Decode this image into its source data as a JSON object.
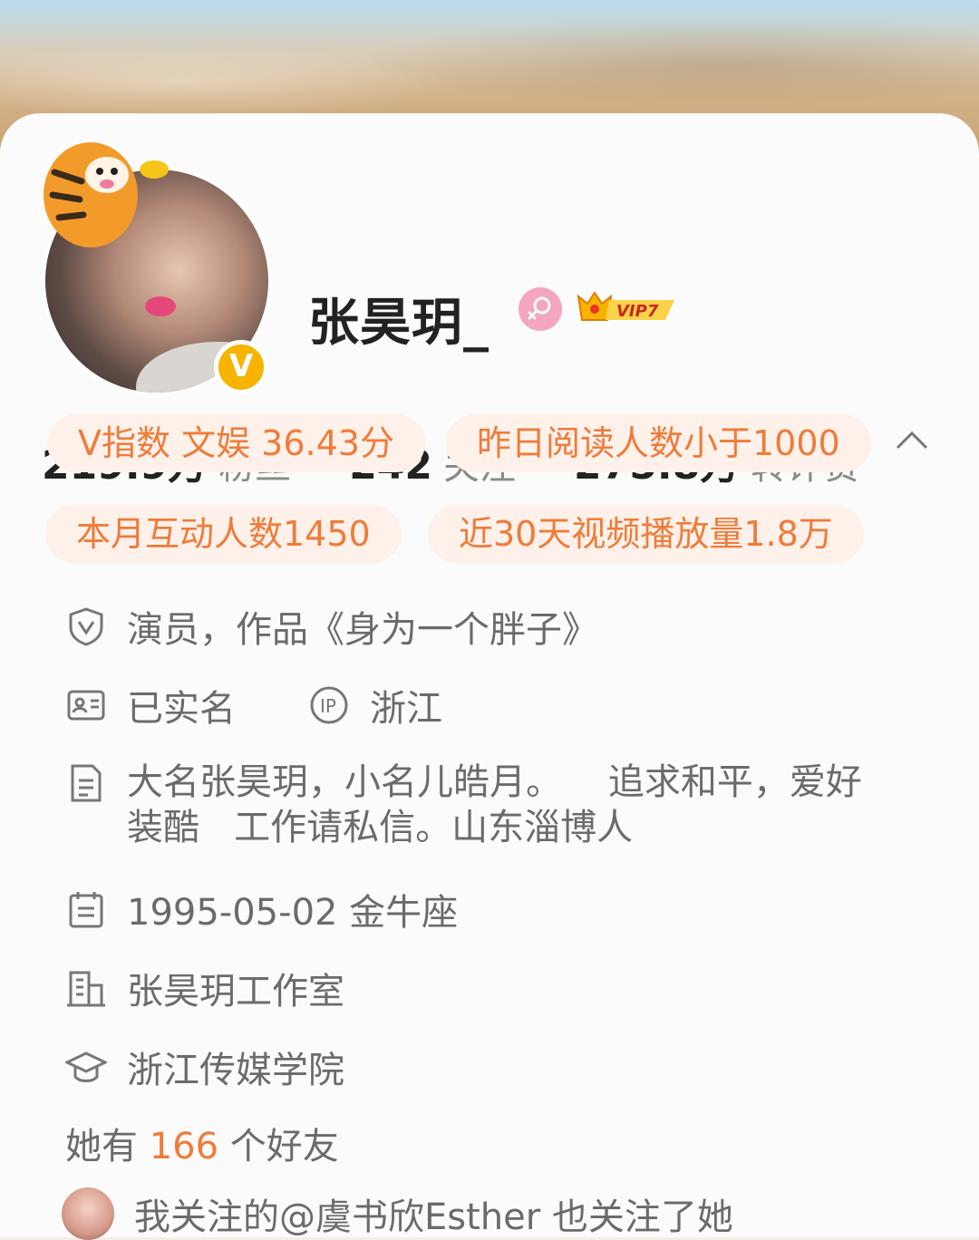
{
  "profile": {
    "name": "张昊玥_",
    "verified_badge": "V",
    "vip_label": "VIP7"
  },
  "stats": [
    {
      "num": "219.9万",
      "label": "粉丝"
    },
    {
      "num": "242",
      "label": "关注"
    },
    {
      "num": "275.8万",
      "label": "转评赞"
    }
  ],
  "tags": [
    "V指数 文娱 36.43分",
    "昨日阅读人数小于1000",
    "本月互动人数1450",
    "近30天视频播放量1.8万"
  ],
  "info": {
    "verification": "演员，作品《身为一个胖子》",
    "realname": "已实名",
    "ip_label": "浙江",
    "bio": "大名张昊玥，小名儿皓月。    追求和平，爱好装酷   工作请私信。山东淄博人",
    "birthday": "1995-05-02 金牛座",
    "company": "张昊玥工作室",
    "school": "浙江传媒学院"
  },
  "friends": {
    "prefix": "她有 ",
    "count": "166",
    "suffix": " 个好友"
  },
  "mutual": "我关注的@虞书欣Esther 也关注了她",
  "colors": {
    "accent": "#f07b39",
    "tag_bg": "#fdf1ea",
    "verified": "#f6b400"
  }
}
